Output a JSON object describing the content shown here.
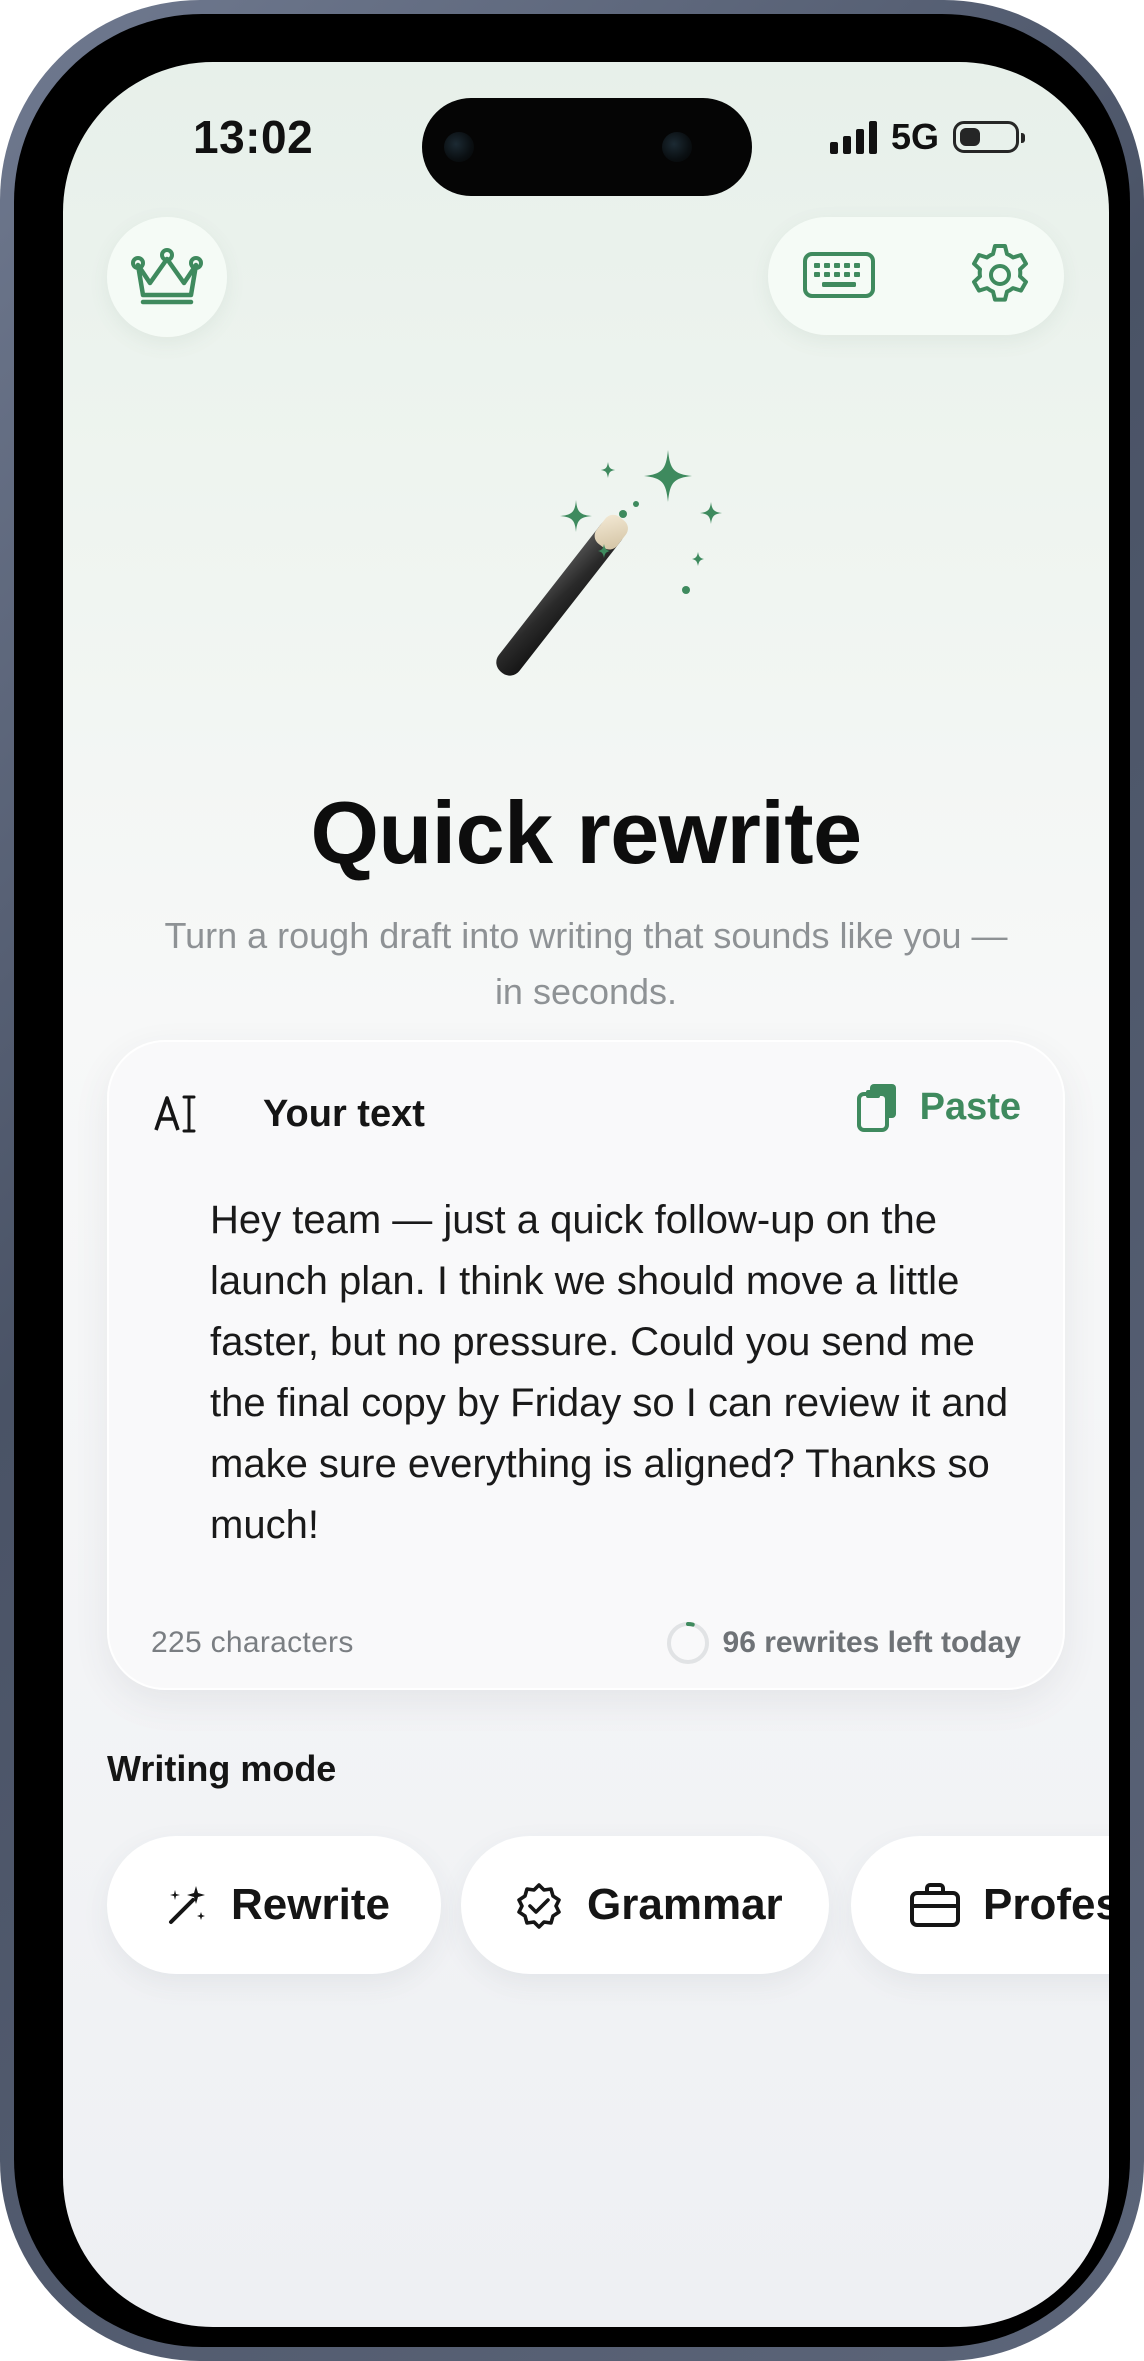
{
  "status_bar": {
    "time": "13:02",
    "network": "5G",
    "battery_level": 0.3
  },
  "header": {
    "premium_icon": "crown-icon",
    "keyboard_icon": "keyboard-icon",
    "settings_icon": "gear-icon"
  },
  "hero": {
    "illustration": "magic-wand-sparkles",
    "title": "Quick rewrite",
    "subtitle": "Turn a rough draft into writing that sounds like you — in seconds."
  },
  "input_card": {
    "label": "Your text",
    "label_icon": "text-cursor-icon",
    "paste_label": "Paste",
    "paste_icon": "clipboard-icon",
    "text": "Hey team — just a quick follow-up on the launch plan. I think we should move a little faster, but no pressure. Could you send me the final copy by Friday so I can review it and make sure everything is aligned? Thanks so much!",
    "char_count": "225 characters",
    "rewrites_left": "96 rewrites left today",
    "rewrites_progress": 0.04
  },
  "writing_mode": {
    "heading": "Writing mode",
    "modes": [
      {
        "label": "Rewrite",
        "icon": "magic-wand-icon"
      },
      {
        "label": "Grammar",
        "icon": "badge-check-icon"
      },
      {
        "label": "Professional",
        "icon": "briefcase-icon"
      }
    ]
  },
  "colors": {
    "accent": "#3f8a5e",
    "title": "#0d0d0d",
    "muted": "#8e9295"
  }
}
